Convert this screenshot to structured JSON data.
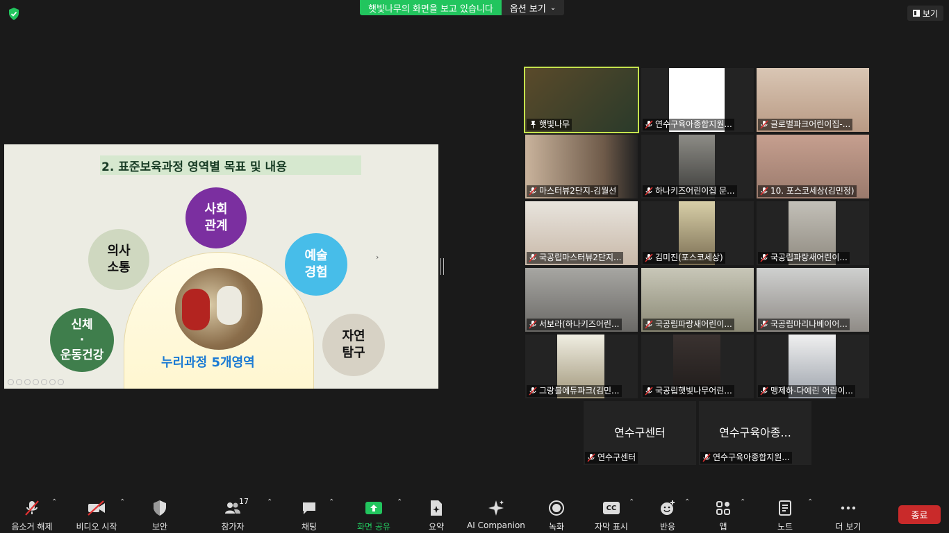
{
  "share_banner": {
    "status": "햇빛나무의 화면을 보고 있습니다",
    "options": "옵션 보기"
  },
  "view_button": "보기",
  "slide": {
    "title": "2. 표준보육과정 영역별 목표 및 내용",
    "center_label": "누리과정 5개영역",
    "circles": {
      "social_line1": "사회",
      "social_line2": "관계",
      "comm_line1": "의사",
      "comm_line2": "소통",
      "art_line1": "예술",
      "art_line2": "경험",
      "body_line1": "신체",
      "body_line2": "·",
      "body_line3": "운동건강",
      "nature_line1": "자연",
      "nature_line2": "탐구"
    }
  },
  "participants": [
    {
      "name": "햇빛나무"
    },
    {
      "name": "연수구육아종합지원..."
    },
    {
      "name": "글로벌파크어린이집-..."
    },
    {
      "name": "마스터뷰2단지-김월선"
    },
    {
      "name": "하나키즈어린이집 문..."
    },
    {
      "name": "10. 포스코세상(김민정)"
    },
    {
      "name": "국공립마스터뷰2단지..."
    },
    {
      "name": "김미진(포스코세상)"
    },
    {
      "name": "국공립파랑새어린이..."
    },
    {
      "name": "서보라(하나키즈어린..."
    },
    {
      "name": "국공립파랑새어린이..."
    },
    {
      "name": "국공립마리나베이어..."
    },
    {
      "name": "그랑블에듀파크(김민..."
    },
    {
      "name": "국공립햇빛나무어린..."
    },
    {
      "name": "맹제하-다예린 어린이..."
    },
    {
      "name": "연수구센터",
      "display": "연수구센터"
    },
    {
      "name": "연수구육아종합지원...",
      "display": "연수구육아종..."
    }
  ],
  "toolbar": {
    "mute": "음소거 해제",
    "video": "비디오 시작",
    "security": "보안",
    "participants": "참가자",
    "participant_count": "17",
    "chat": "채팅",
    "share": "화면 공유",
    "summary": "요약",
    "ai": "AI Companion",
    "record": "녹화",
    "captions": "자막 표시",
    "captions_icon": "CC",
    "reactions": "반응",
    "apps": "앱",
    "notes": "노트",
    "more": "더 보기",
    "end": "종료"
  },
  "colors": {
    "share_green": "#22c55e",
    "end_red": "#c92a2a",
    "active_speaker": "#c5e34d"
  }
}
